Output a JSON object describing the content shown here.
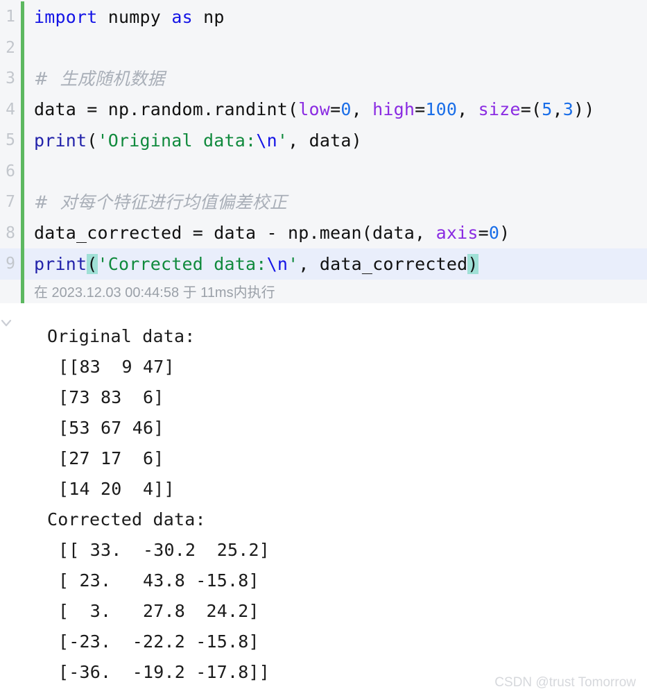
{
  "editor": {
    "accent_color": "#5cb860",
    "active_line_bg": "#e9eefb",
    "bracket_match_bg": "#9fe0d6",
    "background": "#f5f6f8",
    "line_numbers": [
      "1",
      "2",
      "3",
      "4",
      "5",
      "6",
      "7",
      "8",
      "9"
    ],
    "lines": [
      {
        "number": "1",
        "tokens": [
          {
            "text": "import",
            "type": "keyword"
          },
          {
            "text": " ",
            "type": "plain"
          },
          {
            "text": "numpy",
            "type": "plain"
          },
          {
            "text": " ",
            "type": "plain"
          },
          {
            "text": "as",
            "type": "keyword"
          },
          {
            "text": " ",
            "type": "plain"
          },
          {
            "text": "np",
            "type": "plain"
          }
        ]
      },
      {
        "number": "2",
        "tokens": []
      },
      {
        "number": "3",
        "tokens": [
          {
            "text": "#  生成随机数据",
            "type": "comment"
          }
        ]
      },
      {
        "number": "4",
        "tokens": [
          {
            "text": "data = np.random.randint(",
            "type": "plain"
          },
          {
            "text": "low",
            "type": "param"
          },
          {
            "text": "=",
            "type": "plain"
          },
          {
            "text": "0",
            "type": "number"
          },
          {
            "text": ", ",
            "type": "plain"
          },
          {
            "text": "high",
            "type": "param"
          },
          {
            "text": "=",
            "type": "plain"
          },
          {
            "text": "100",
            "type": "number"
          },
          {
            "text": ", ",
            "type": "plain"
          },
          {
            "text": "size",
            "type": "param"
          },
          {
            "text": "=(",
            "type": "plain"
          },
          {
            "text": "5",
            "type": "number"
          },
          {
            "text": ",",
            "type": "plain"
          },
          {
            "text": "3",
            "type": "number"
          },
          {
            "text": "))",
            "type": "plain"
          }
        ]
      },
      {
        "number": "5",
        "tokens": [
          {
            "text": "print",
            "type": "function"
          },
          {
            "text": "(",
            "type": "plain"
          },
          {
            "text": "'Original data:",
            "type": "string"
          },
          {
            "text": "\\n",
            "type": "escape"
          },
          {
            "text": "'",
            "type": "string"
          },
          {
            "text": ", data)",
            "type": "plain"
          }
        ]
      },
      {
        "number": "6",
        "tokens": []
      },
      {
        "number": "7",
        "tokens": [
          {
            "text": "#  对每个特征进行均值偏差校正",
            "type": "comment"
          }
        ]
      },
      {
        "number": "8",
        "tokens": [
          {
            "text": "data_corrected = data - np.mean(data, ",
            "type": "plain"
          },
          {
            "text": "axis",
            "type": "param"
          },
          {
            "text": "=",
            "type": "plain"
          },
          {
            "text": "0",
            "type": "number"
          },
          {
            "text": ")",
            "type": "plain"
          }
        ]
      },
      {
        "number": "9",
        "active": true,
        "tokens": [
          {
            "text": "print",
            "type": "function"
          },
          {
            "text": "(",
            "type": "plain",
            "bracket_match": true
          },
          {
            "text": "'Corrected data:",
            "type": "string"
          },
          {
            "text": "\\n",
            "type": "escape"
          },
          {
            "text": "'",
            "type": "string"
          },
          {
            "text": ", data_corrected",
            "type": "plain"
          },
          {
            "text": ")",
            "type": "plain",
            "bracket_match": true
          }
        ]
      }
    ]
  },
  "execution": {
    "status_text": "在 2023.12.03 00:44:58 于 11ms内执行"
  },
  "output": {
    "collapse_icon": "chevron-down-icon",
    "lines": [
      {
        "text": "Original data:",
        "indent": 0
      },
      {
        "text": "[[83  9 47]",
        "indent": 1
      },
      {
        "text": "[73 83  6]",
        "indent": 1
      },
      {
        "text": "[53 67 46]",
        "indent": 1
      },
      {
        "text": "[27 17  6]",
        "indent": 1
      },
      {
        "text": "[14 20  4]]",
        "indent": 1
      },
      {
        "text": "Corrected data:",
        "indent": 0
      },
      {
        "text": "[[ 33.  -30.2  25.2]",
        "indent": 1
      },
      {
        "text": "[ 23.   43.8 -15.8]",
        "indent": 1
      },
      {
        "text": "[  3.   27.8  24.2]",
        "indent": 1
      },
      {
        "text": "[-23.  -22.2 -15.8]",
        "indent": 1
      },
      {
        "text": "[-36.  -19.2 -17.8]]",
        "indent": 1
      }
    ]
  },
  "watermark": {
    "text": "CSDN @trust Tomorrow"
  }
}
